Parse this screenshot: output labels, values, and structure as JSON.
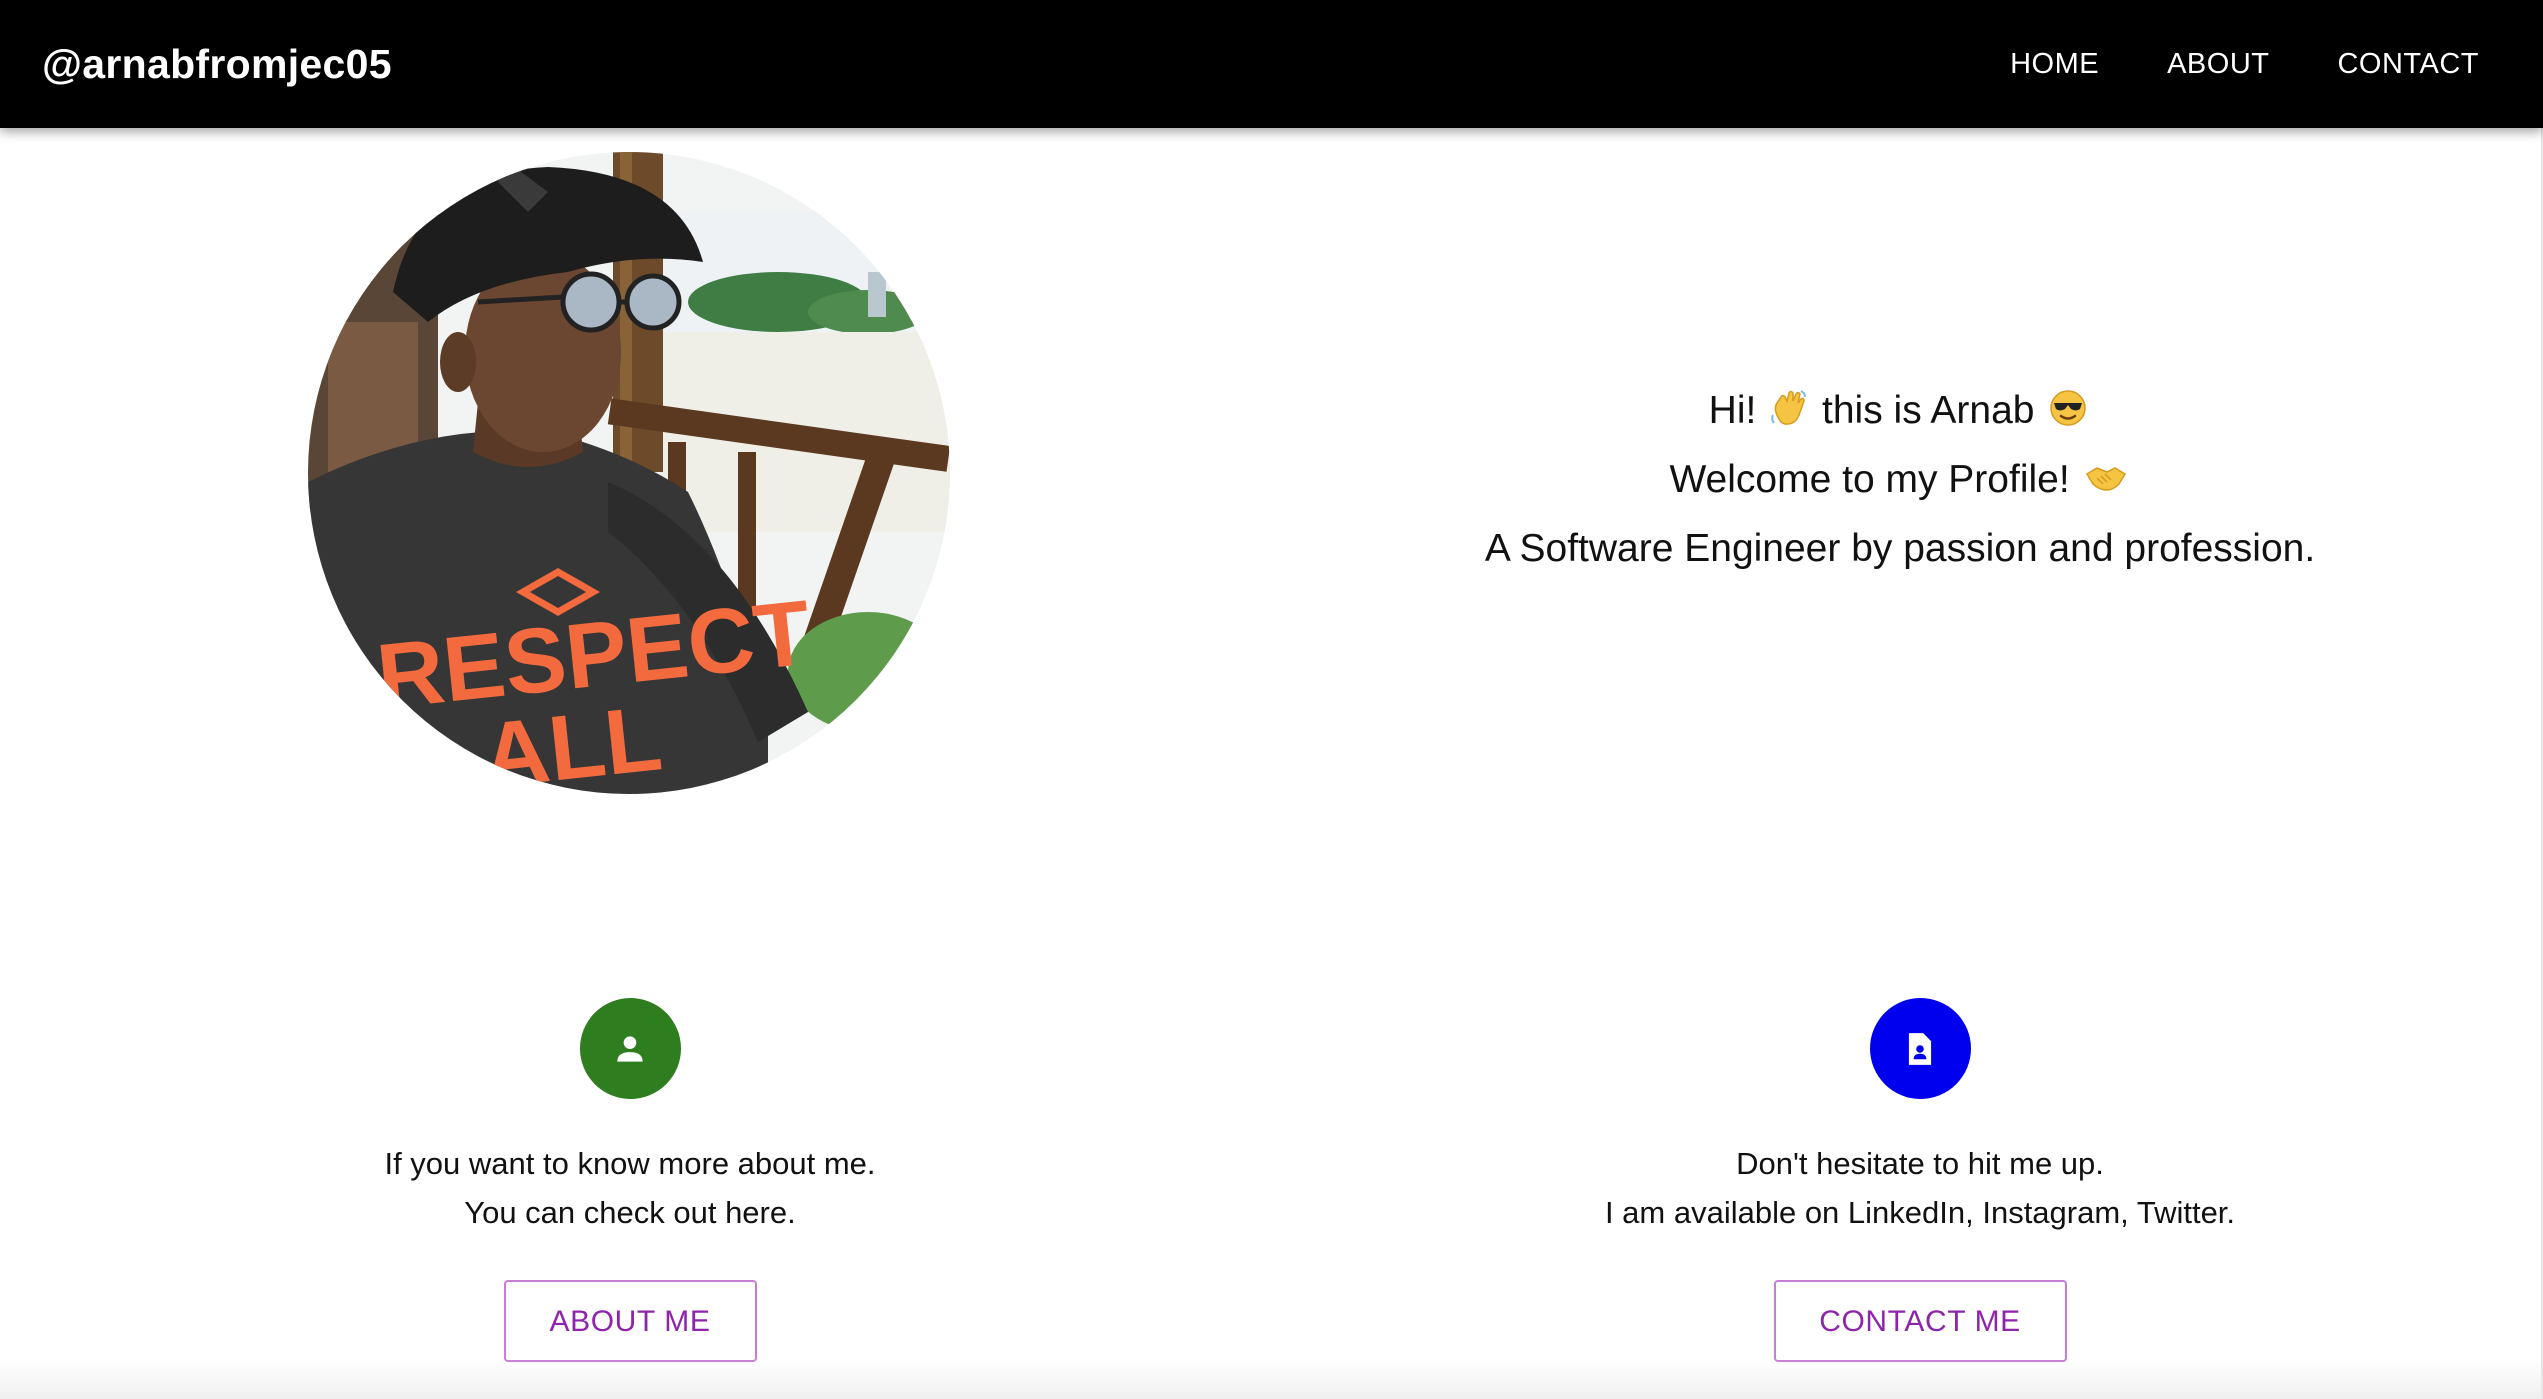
{
  "navbar": {
    "brand": "@arnabfromjec05",
    "links": [
      {
        "label": "HOME"
      },
      {
        "label": "ABOUT"
      },
      {
        "label": "CONTACT"
      }
    ]
  },
  "profile_photo": {
    "alt": "Profile photo of Arnab wearing a cap and sunglasses, RESPECT ALL t-shirt",
    "shirt_text_1": "RESPECT",
    "shirt_text_2": "ALL"
  },
  "intro": {
    "line1_a": "Hi!",
    "line1_b": "this is Arnab",
    "line2": "Welcome to my Profile!",
    "line3": "A Software Engineer by passion and profession."
  },
  "about_card": {
    "icon": "person-icon",
    "line1": "If you want to know more about me.",
    "line2": "You can check out here.",
    "button_label": "ABOUT ME"
  },
  "contact_card": {
    "icon": "contact-page-icon",
    "line1": "Don't hesitate to hit me up.",
    "line2": "I am available on LinkedIn, Instagram, Twitter.",
    "button_label": "CONTACT ME"
  },
  "colors": {
    "navbar_bg": "#000000",
    "about_icon_bg": "#2e7d1f",
    "contact_icon_bg": "#0000ee",
    "button_text": "#8e24aa",
    "button_border": "#c67fd6"
  }
}
